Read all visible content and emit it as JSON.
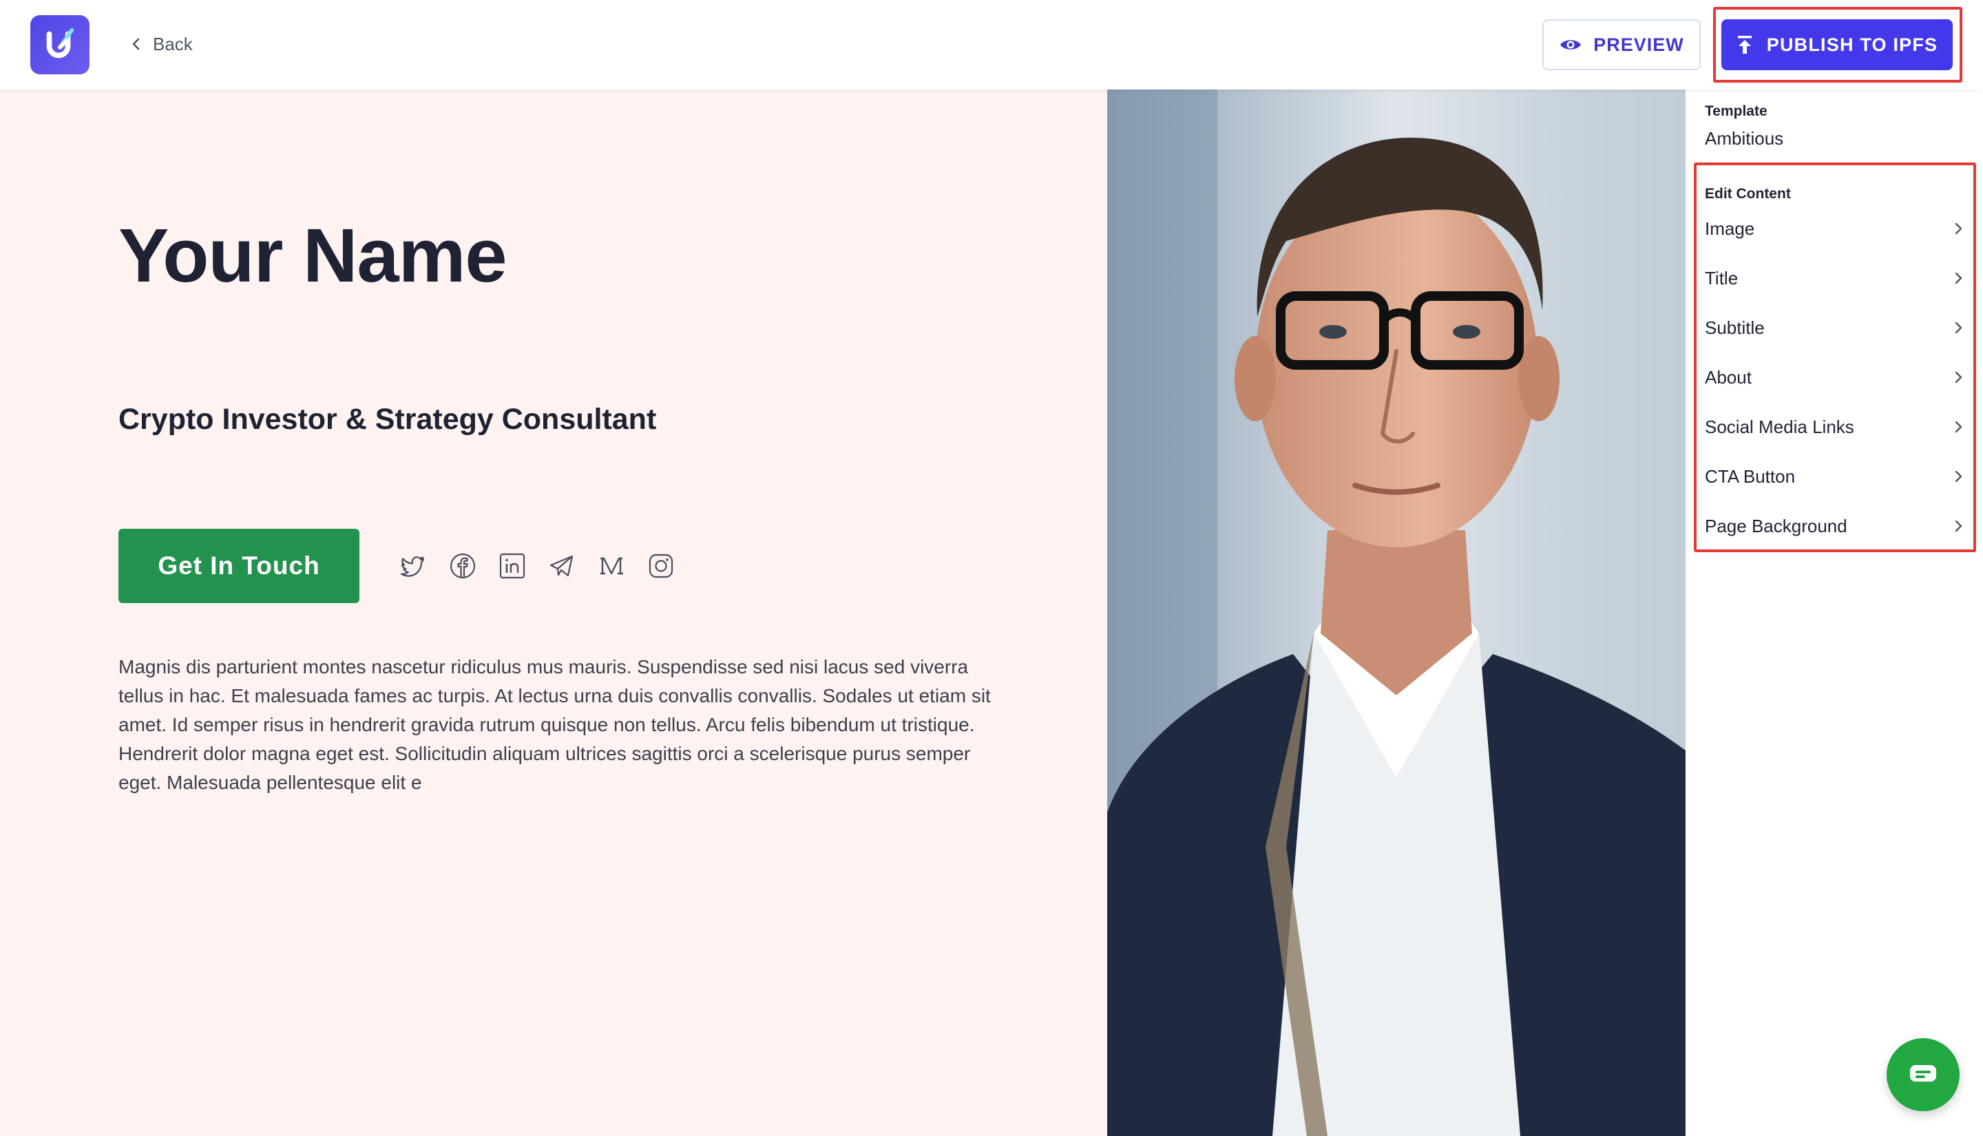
{
  "header": {
    "back_label": "Back",
    "preview_label": "PREVIEW",
    "publish_label": "PUBLISH TO IPFS"
  },
  "profile": {
    "name": "Your Name",
    "subtitle": "Crypto Investor & Strategy Consultant",
    "cta_label": "Get In Touch",
    "about": "Magnis dis parturient montes nascetur ridiculus mus mauris. Suspendisse sed nisi lacus sed viverra tellus in hac. Et malesuada fames ac turpis. At lectus urna duis convallis convallis. Sodales ut etiam sit amet. Id semper risus in hendrerit gravida rutrum quisque non tellus. Arcu felis bibendum ut tristique. Hendrerit dolor magna eget est. Sollicitudin aliquam ultrices sagittis orci a scelerisque purus semper eget. Malesuada pellentesque elit e",
    "social_icons": [
      "twitter-icon",
      "facebook-icon",
      "linkedin-icon",
      "telegram-icon",
      "medium-icon",
      "instagram-icon"
    ]
  },
  "panel": {
    "template_label": "Template",
    "template_value": "Ambitious",
    "edit_label": "Edit Content",
    "items": [
      {
        "label": "Image"
      },
      {
        "label": "Title"
      },
      {
        "label": "Subtitle"
      },
      {
        "label": "About"
      },
      {
        "label": "Social Media Links"
      },
      {
        "label": "CTA Button"
      },
      {
        "label": "Page Background"
      }
    ]
  },
  "colors": {
    "brand": "#4338ea",
    "cta_green": "#23924f",
    "canvas_bg": "#fff3f1",
    "highlight_red": "#e53935",
    "chat_green": "#21a840"
  }
}
